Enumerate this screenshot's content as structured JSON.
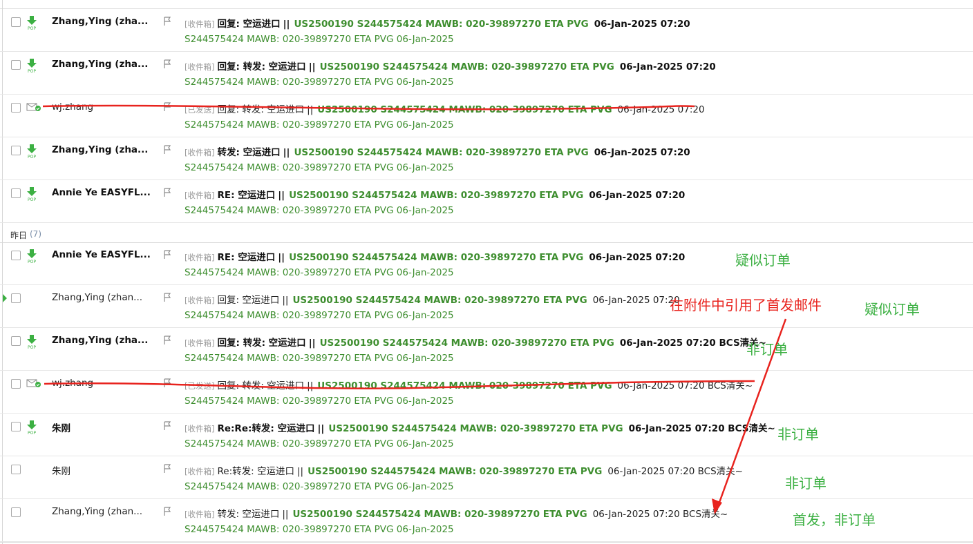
{
  "group_yesterday": {
    "label": "昨日",
    "count": "(7)"
  },
  "emails": [
    {
      "sender": "Zhang,Ying (zha...",
      "tag": "[收件箱]",
      "prefix": "回复: 空运进口",
      "sep": "||",
      "code": "US2500190 S244575424 MAWB: 020-39897270 ETA PVG",
      "date": "06-Jan-2025 07:20",
      "snippet": "S244575424 MAWB: 020-39897270 ETA PVG 06-Jan-2025",
      "icon": "pop-download-icon"
    },
    {
      "sender": "Zhang,Ying (zha...",
      "tag": "[收件箱]",
      "prefix": "回复: 转发: 空运进口",
      "sep": "||",
      "code": "US2500190 S244575424 MAWB: 020-39897270 ETA PVG",
      "date": "06-Jan-2025 07:20",
      "snippet": "S244575424 MAWB: 020-39897270 ETA PVG 06-Jan-2025",
      "icon": "pop-download-icon"
    },
    {
      "sender": "wj.zhang",
      "tag": "[已发送]",
      "prefix": "回复: 转发: 空运进口",
      "sep": "||",
      "code": "US2500190 S244575424 MAWB: 020-39897270 ETA PVG",
      "date": "06-Jan-2025 07:20",
      "snippet": "S244575424 MAWB: 020-39897270 ETA PVG 06-Jan-2025",
      "icon": "sent-envelope-icon"
    },
    {
      "sender": "Zhang,Ying (zha...",
      "tag": "[收件箱]",
      "prefix": "转发: 空运进口",
      "sep": "||",
      "code": "US2500190 S244575424 MAWB: 020-39897270 ETA PVG",
      "date": "06-Jan-2025 07:20",
      "snippet": "S244575424 MAWB: 020-39897270 ETA PVG 06-Jan-2025",
      "icon": "pop-download-icon"
    },
    {
      "sender": "Annie Ye EASYFL...",
      "tag": "[收件箱]",
      "prefix": "RE: 空运进口",
      "sep": "||",
      "code": "US2500190 S244575424 MAWB: 020-39897270 ETA PVG",
      "date": "06-Jan-2025 07:20",
      "snippet": "S244575424 MAWB: 020-39897270 ETA PVG 06-Jan-2025",
      "icon": "pop-download-icon"
    },
    {
      "sender": "Annie Ye EASYFL...",
      "tag": "[收件箱]",
      "prefix": "RE: 空运进口",
      "sep": "||",
      "code": "US2500190 S244575424 MAWB: 020-39897270 ETA PVG",
      "date": "06-Jan-2025 07:20",
      "snippet": "S244575424 MAWB: 020-39897270 ETA PVG 06-Jan-2025",
      "icon": "pop-download-icon"
    },
    {
      "sender": "Zhang,Ying (zhan...",
      "tag": "[收件箱]",
      "prefix": "回复: 空运进口",
      "sep": "||",
      "code": "US2500190 S244575424 MAWB: 020-39897270 ETA PVG",
      "date": "06-Jan-2025 07:20",
      "snippet": "S244575424 MAWB: 020-39897270 ETA PVG 06-Jan-2025",
      "icon": "none"
    },
    {
      "sender": "Zhang,Ying (zha...",
      "tag": "[收件箱]",
      "prefix": "回复: 转发: 空运进口",
      "sep": "||",
      "code": "US2500190 S244575424 MAWB: 020-39897270 ETA PVG",
      "date": "06-Jan-2025 07:20 BCS清关~",
      "snippet": "S244575424 MAWB: 020-39897270 ETA PVG 06-Jan-2025",
      "icon": "pop-download-icon"
    },
    {
      "sender": "wj.zhang",
      "tag": "[已发送]",
      "prefix": "回复: 转发: 空运进口",
      "sep": "||",
      "code": "US2500190 S244575424 MAWB: 020-39897270 ETA PVG",
      "date": "06-Jan-2025 07:20 BCS清关~",
      "snippet": "S244575424 MAWB: 020-39897270 ETA PVG 06-Jan-2025",
      "icon": "sent-envelope-icon"
    },
    {
      "sender": "朱刚",
      "tag": "[收件箱]",
      "prefix": "Re:Re:转发: 空运进口",
      "sep": "||",
      "code": "US2500190 S244575424 MAWB: 020-39897270 ETA PVG",
      "date": "06-Jan-2025 07:20 BCS清关~",
      "snippet": "S244575424 MAWB: 020-39897270 ETA PVG 06-Jan-2025",
      "icon": "pop-download-icon"
    },
    {
      "sender": "朱刚",
      "tag": "[收件箱]",
      "prefix": "Re:转发: 空运进口",
      "sep": "||",
      "code": "US2500190 S244575424 MAWB: 020-39897270 ETA PVG",
      "date": "06-Jan-2025 07:20 BCS清关~",
      "snippet": "S244575424 MAWB: 020-39897270 ETA PVG 06-Jan-2025",
      "icon": "none"
    },
    {
      "sender": "Zhang,Ying (zhan...",
      "tag": "[收件箱]",
      "prefix": "转发: 空运进口",
      "sep": "||",
      "code": "US2500190 S244575424 MAWB: 020-39897270 ETA PVG",
      "date": "06-Jan-2025 07:20 BCS清关~",
      "snippet": "S244575424 MAWB: 020-39897270 ETA PVG 06-Jan-2025",
      "icon": "none"
    }
  ],
  "annotations": {
    "n1": "疑似订单",
    "n2": "在附件中引用了首发邮件",
    "n3": "疑似订单",
    "n4": "非订单",
    "n5": "非订单",
    "n6": "非订单",
    "n7": "首发，非订单"
  },
  "colors": {
    "accent_green": "#3e8e2f",
    "annotation_green": "#3cb043",
    "annotation_red": "#e8231e"
  }
}
